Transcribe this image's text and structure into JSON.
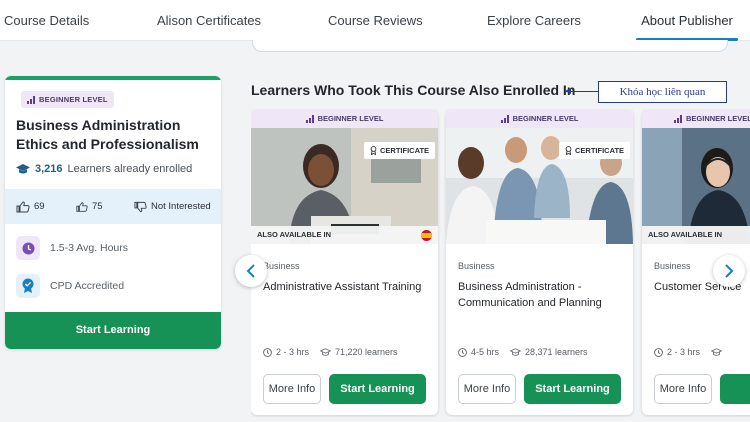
{
  "tabs": [
    {
      "label": "Course Details"
    },
    {
      "label": "Alison Certificates"
    },
    {
      "label": "Course Reviews"
    },
    {
      "label": "Explore Careers"
    },
    {
      "label": "About Publisher",
      "active": true
    }
  ],
  "left_card": {
    "level": "BEGINNER LEVEL",
    "title": "Business Administration Ethics and Professionalism",
    "enrolled_count": "3,216",
    "enrolled_label": "Learners already enrolled",
    "likes": "69",
    "thumbs": "75",
    "not_interested": "Not Interested",
    "hours": "1.5-3 Avg. Hours",
    "accredited": "CPD Accredited",
    "start_label": "Start Learning"
  },
  "section": {
    "title": "Learners Who Took This Course Also Enrolled In",
    "annotation": "Khóa học liên quan"
  },
  "courses": [
    {
      "level": "BEGINNER LEVEL",
      "certificate": "CERTIFICATE",
      "also_available": "ALSO AVAILABLE IN",
      "category": "Business",
      "title": "Administrative Assistant Training",
      "hours": "2 - 3 hrs",
      "learners": "71,220 learners",
      "more_label": "More Info",
      "start_label": "Start Learning"
    },
    {
      "level": "BEGINNER LEVEL",
      "certificate": "CERTIFICATE",
      "category": "Business",
      "title": "Business Administration - Communication and Planning",
      "hours": "4-5 hrs",
      "learners": "28,371 learners",
      "more_label": "More Info",
      "start_label": "Start Learning"
    },
    {
      "level": "BEGINNER LEVEL",
      "also_available": "ALSO AVAILABLE IN",
      "category": "Business",
      "title": "Customer Service",
      "hours": "2 - 3 hrs",
      "more_label": "More Info"
    }
  ],
  "colors": {
    "accent_green": "#179257",
    "tab_underline": "#1a7fc1",
    "level_badge_bg": "#efe7f7",
    "stats_band_bg": "#e4f0fa",
    "annotation": "#2b3b8c"
  }
}
